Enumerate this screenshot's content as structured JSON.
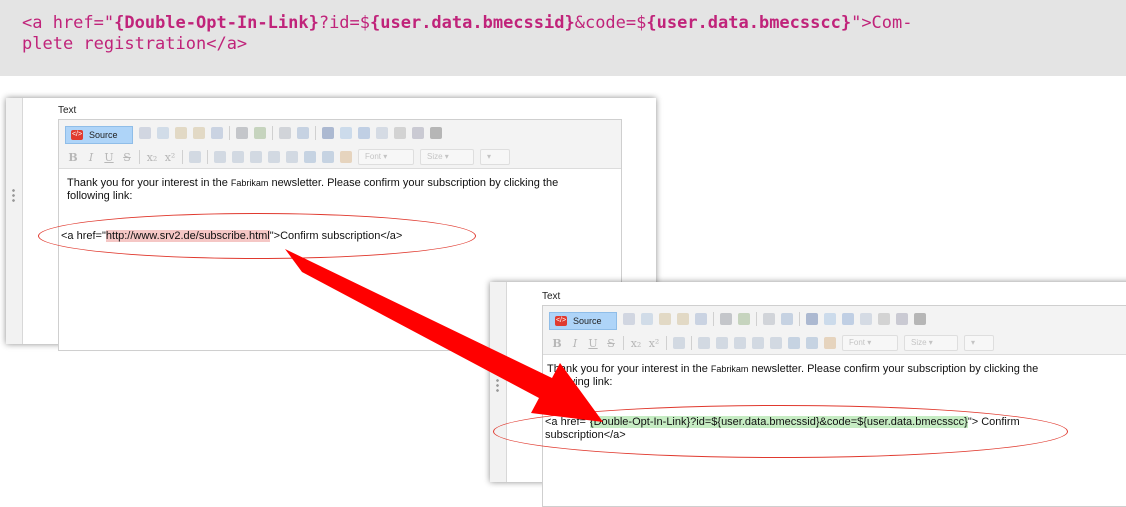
{
  "code_block": {
    "prefix": "<a href=\"",
    "bold1": "{Double-Opt-In-Link}",
    "mid1": "?id=$",
    "bold2": "{user.data.bmecssid}",
    "mid2": "&code=$",
    "bold3": "{user.data.bmecsscc}",
    "suffix1": "\">Com-",
    "line2": "plete registration</a>"
  },
  "editor_before": {
    "field_label": "Text",
    "source_label": "Source",
    "font_label": "Font",
    "size_label": "Size",
    "line1_pre": "Thank you for your interest in the ",
    "line1_brand": "Fabrikam",
    "line1_post": " newsletter. Please confirm your subscription by clicking the",
    "line2": "following link:",
    "link_prefix": "<a href=\"",
    "link_url": "http://www.srv2.de/subscribe.html",
    "link_suffix": "\">Confirm subscription</a>"
  },
  "editor_after": {
    "field_label": "Text",
    "source_label": "Source",
    "font_label": "Font",
    "size_label": "Size",
    "line1_pre": "Thank you for your interest in the ",
    "line1_brand": "Fabrikam",
    "line1_post": " newsletter. Please confirm your subscription by clicking the",
    "line2": "following link:",
    "link_prefix": "<a href=\"",
    "link_url": "{Double-Opt-In-Link}?id=${user.data.bmecssid}&code=${user.data.bmecsscc}",
    "link_suffix": "\"> Confirm",
    "link_line2": "subscription</a>"
  },
  "colors": {
    "code_text": "#c0237a",
    "code_bg": "#e4e4e4",
    "arrow": "#ff0000",
    "ellipse": "#e0392e",
    "highlight_old": "#f5c7c5",
    "highlight_new": "#c6ecc3"
  }
}
